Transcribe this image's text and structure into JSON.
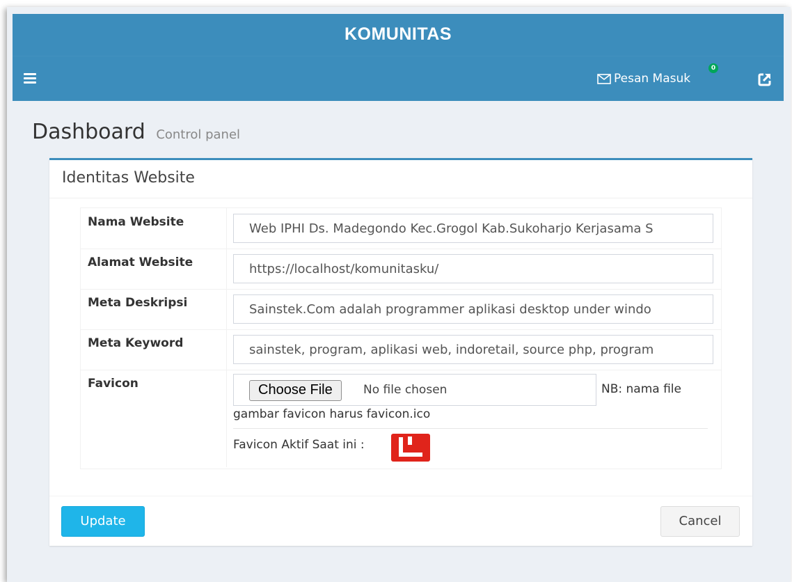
{
  "app": {
    "title": "KOMUNITAS"
  },
  "navbar": {
    "menu_icon": "hamburger-icon",
    "messages_icon": "envelope-icon",
    "messages_label": "Pesan Masuk",
    "messages_count": "0",
    "external_icon": "external-link-icon"
  },
  "page": {
    "title": "Dashboard",
    "subtitle": "Control panel"
  },
  "box": {
    "title": "Identitas Website",
    "fields": {
      "nama_website": {
        "label": "Nama Website",
        "value": "Web IPHI Ds. Madegondo Kec.Grogol Kab.Sukoharjo Kerjasama S"
      },
      "alamat_website": {
        "label": "Alamat Website",
        "value": "https://localhost/komunitasku/"
      },
      "meta_deskripsi": {
        "label": "Meta Deskripsi",
        "value": "Sainstek.Com adalah programmer aplikasi desktop under windo"
      },
      "meta_keyword": {
        "label": "Meta Keyword",
        "value": "sainstek, program, aplikasi web, indoretail, source php, program"
      },
      "favicon": {
        "label": "Favicon",
        "choose_label": "Choose File",
        "file_status": "No file chosen",
        "note_part1": "NB: nama file",
        "note_part2": "gambar favicon harus favicon.ico",
        "active_label": "Favicon Aktif Saat ini :",
        "favicon_icon": "favicon-image"
      }
    },
    "buttons": {
      "update": "Update",
      "cancel": "Cancel"
    }
  },
  "colors": {
    "header": "#3c8dbc",
    "update_button": "#1fb5e9",
    "favicon": "#e0241b"
  }
}
